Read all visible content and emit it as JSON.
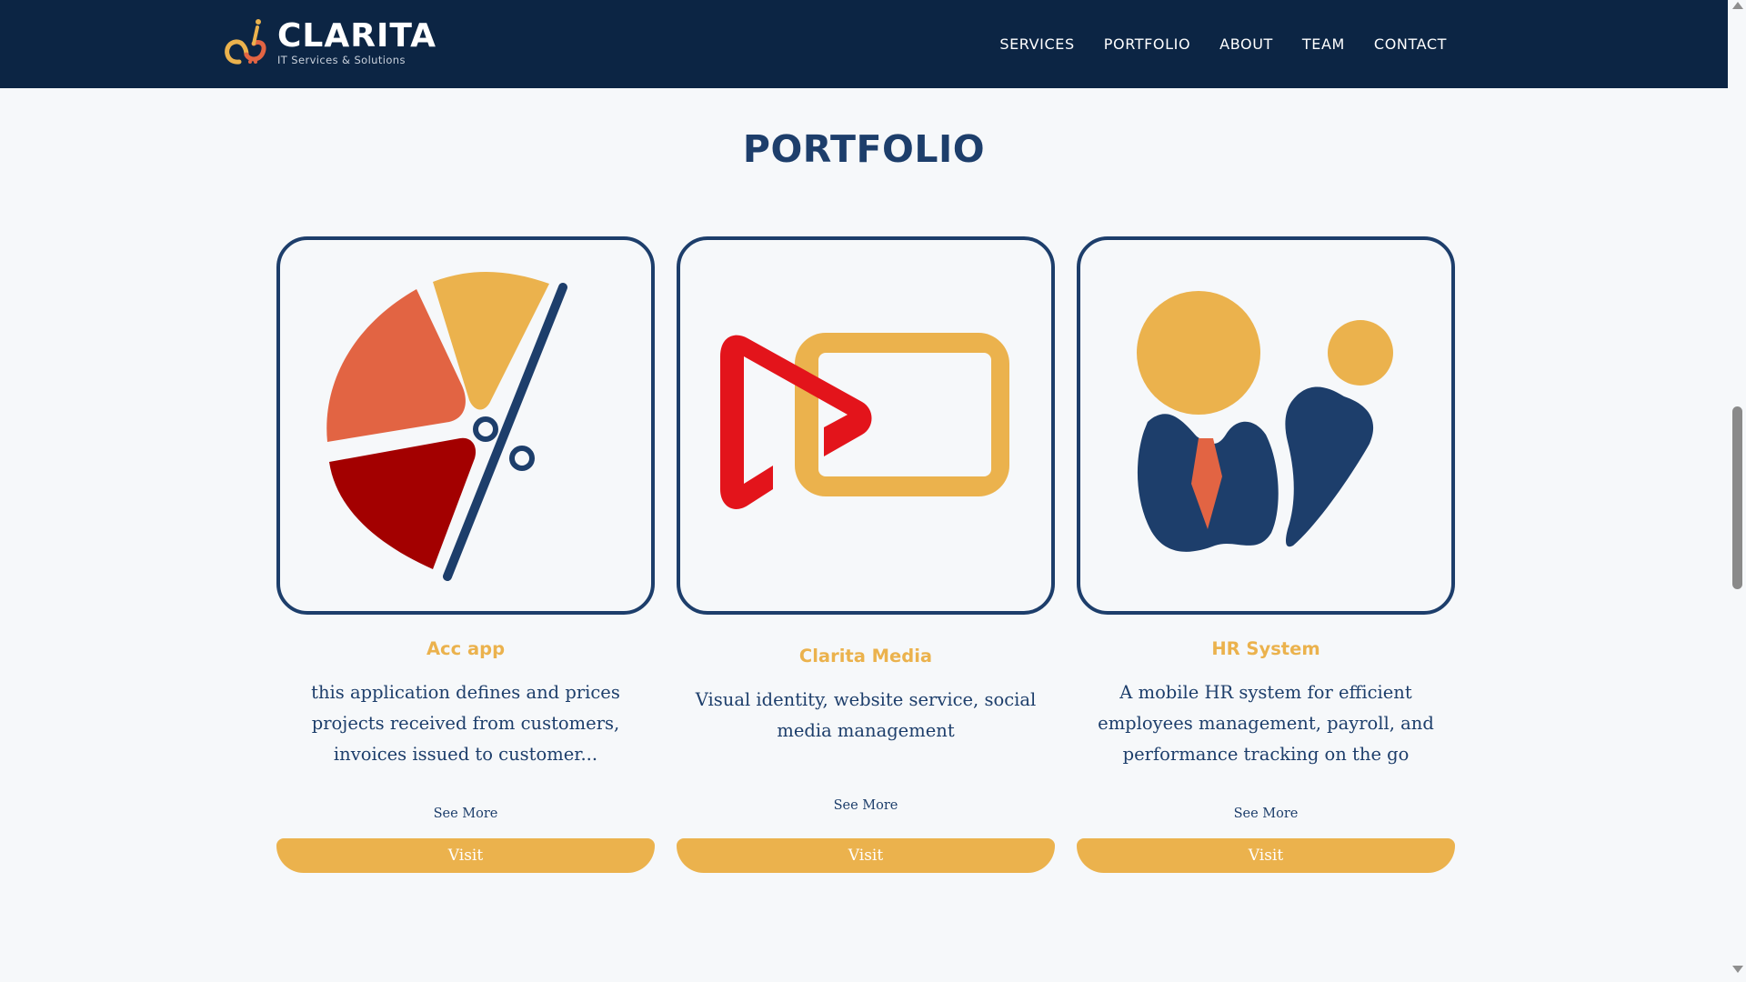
{
  "header": {
    "brand_name": "CLARITA",
    "brand_tagline": "IT Services & Solutions",
    "nav": [
      {
        "label": "SERVICES"
      },
      {
        "label": "PORTFOLIO"
      },
      {
        "label": "ABOUT"
      },
      {
        "label": "TEAM"
      },
      {
        "label": "CONTACT"
      }
    ]
  },
  "section": {
    "title": "PORTFOLIO"
  },
  "cards": [
    {
      "icon": "pie-chart-percent-icon",
      "name": "Acc app",
      "description": "this application defines and prices projects received from customers, invoices issued to customer...",
      "see_more": "See More",
      "visit": "Visit"
    },
    {
      "icon": "media-play-frame-icon",
      "name": "Clarita Media",
      "description": "Visual identity, website service, social media management",
      "see_more": "See More",
      "visit": "Visit"
    },
    {
      "icon": "hr-people-icon",
      "name": "HR System",
      "description": "A mobile HR system for efficient employees management, payroll, and performance tracking on the go",
      "see_more": "See More",
      "visit": "Visit"
    }
  ],
  "colors": {
    "navbar": "#0c2544",
    "title": "#1d3e6b",
    "accent": "#ebb24d",
    "orange": "#e26443",
    "red": "#e3141b",
    "dark_red": "#a30000"
  }
}
